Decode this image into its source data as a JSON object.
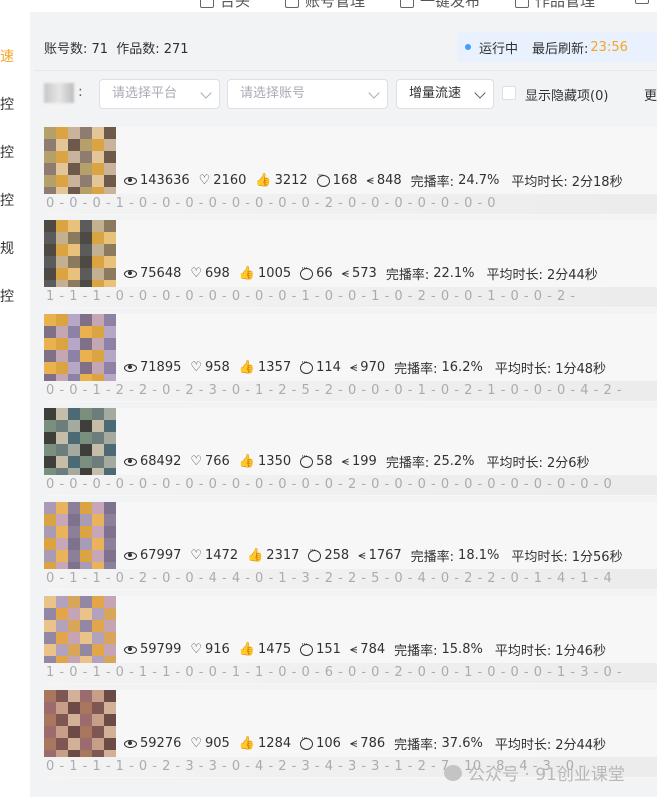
{
  "nav": {
    "brand": "",
    "items": [
      "台头",
      "账号管理",
      "一键发布",
      "作品管理"
    ]
  },
  "sidebar": {
    "items": [
      {
        "label": "速",
        "active": true
      },
      {
        "label": "控",
        "active": false
      },
      {
        "label": "控",
        "active": false
      },
      {
        "label": "控",
        "active": false
      },
      {
        "label": "规",
        "active": false
      },
      {
        "label": "控",
        "active": false
      }
    ]
  },
  "summary": {
    "accounts_label": "账号数:",
    "accounts_value": "71",
    "works_label": "作品数:",
    "works_value": "271",
    "status": "运行中",
    "refresh_label": "最后刷新:",
    "refresh_time": "23:56"
  },
  "filters": {
    "colon": ":",
    "platform_placeholder": "请选择平台",
    "account_placeholder": "请选择账号",
    "sort_value": "增量流速",
    "show_hidden_label": "显示隐藏项(0)",
    "more_label": "更"
  },
  "works": [
    {
      "views": "143636",
      "likes": "2160",
      "thumbs": "3212",
      "comments": "168",
      "shares": "848",
      "completion_label": "完播率:",
      "completion": "24.7%",
      "avg_label": "平均时长:",
      "avg_duration": "2分18秒",
      "timeline": "0 - 0 - 0 - 1 - 0 - 0 - 0 - 0 - 0 - 0 - 0 - 0 - 2 - 0 - 0 - 0 - 0 - 0 - 0 - 0"
    },
    {
      "views": "75648",
      "likes": "698",
      "thumbs": "1005",
      "comments": "66",
      "shares": "573",
      "completion_label": "完播率:",
      "completion": "22.1%",
      "avg_label": "平均时长:",
      "avg_duration": "2分44秒",
      "timeline": "1 - 1 - 1 - 0 - 0 - 0 - 0 - 0 - 0 - 0 - 0 - 1 - 0 - 0 - 1 - 0 - 2 - 0 - 0 - 1 - 0 - 0 - 2 -"
    },
    {
      "views": "71895",
      "likes": "958",
      "thumbs": "1357",
      "comments": "114",
      "shares": "970",
      "completion_label": "完播率:",
      "completion": "16.2%",
      "avg_label": "平均时长:",
      "avg_duration": "1分48秒",
      "timeline": "0 - 0 - 1 - 2 - 2 - 0 - 2 - 3 - 0 - 1 - 2 - 5 - 2 - 0 - 0 - 0 - 1 - 0 - 2 - 1 - 0 - 0 - 0 - 4 - 2 -"
    },
    {
      "views": "68492",
      "likes": "766",
      "thumbs": "1350",
      "comments": "58",
      "shares": "199",
      "completion_label": "完播率:",
      "completion": "25.2%",
      "avg_label": "平均时长:",
      "avg_duration": "2分6秒",
      "timeline": "0 - 0 - 0 - 0 - 0 - 0 - 0 - 0 - 0 - 0 - 0 - 0 - 0 - 2 - 0 - 0 - 0 - 0 - 0 - 0 - 0 - 0 - 0 - 0 - 0"
    },
    {
      "views": "67997",
      "likes": "1472",
      "thumbs": "2317",
      "comments": "258",
      "shares": "1767",
      "completion_label": "完播率:",
      "completion": "18.1%",
      "avg_label": "平均时长:",
      "avg_duration": "1分56秒",
      "timeline": "0 - 1 - 1 - 0 - 2 - 0 - 0 - 4 - 4 - 0 - 1 - 3 - 2 - 2 - 5 - 0 - 4 - 0 - 2 - 2 - 0 - 1 - 4 - 1 - 4"
    },
    {
      "views": "59799",
      "likes": "916",
      "thumbs": "1475",
      "comments": "151",
      "shares": "784",
      "completion_label": "完播率:",
      "completion": "15.8%",
      "avg_label": "平均时长:",
      "avg_duration": "1分46秒",
      "timeline": "1 - 0 - 1 - 0 - 1 - 1 - 0 - 0 - 1 - 1 - 0 - 0 - 6 - 0 - 0 - 2 - 0 - 0 - 1 - 0 - 0 - 0 - 1 - 3 - 0 -"
    },
    {
      "views": "59276",
      "likes": "905",
      "thumbs": "1284",
      "comments": "106",
      "shares": "786",
      "completion_label": "完播率:",
      "completion": "37.6%",
      "avg_label": "平均时长:",
      "avg_duration": "2分44秒",
      "timeline": "0 - 1 - 1 - 1 - 0 - 2 - 3 - 3 - 0 - 4 - 2 - 3 - 4 - 3 - 3 - 1 - 2 - 7 - 10 - 8 - 4 - 3 - 0 -"
    }
  ],
  "watermark": "公众号 · 91创业课堂"
}
